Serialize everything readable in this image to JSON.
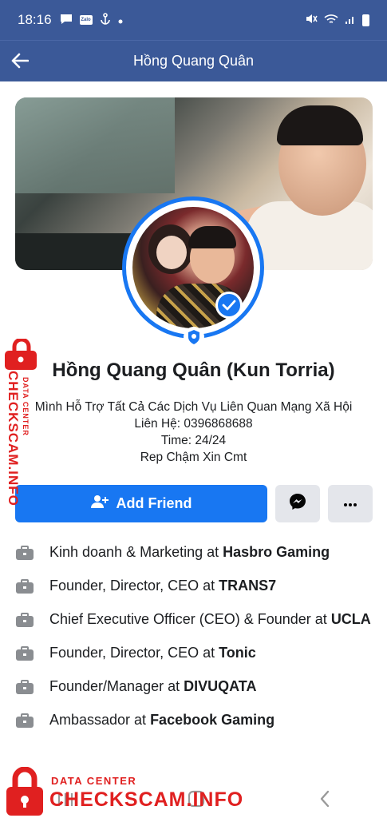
{
  "status_bar": {
    "time": "18:16",
    "left_icons": [
      "message-icon",
      "zalo-icon",
      "anchor-icon",
      "dot-icon"
    ],
    "zalo_label": "Zalo",
    "right_icons": [
      "mute-icon",
      "wifi-icon",
      "signal-icon",
      "battery-icon"
    ]
  },
  "header": {
    "title": "Hồng Quang Quân",
    "back_icon": "arrow-left-icon"
  },
  "profile": {
    "name": "Hồng Quang Quân (Kun Torria)",
    "bio": [
      "Mình Hỗ Trợ Tất Cả Các Dịch Vụ Liên Quan Mạng Xã Hội",
      "Liên Hệ: 0396868688",
      "Time: 24/24",
      "Rep Chậm Xin Cmt"
    ]
  },
  "actions": {
    "add_friend_label": "Add Friend",
    "messenger_icon": "messenger-icon",
    "more_icon": "more-icon"
  },
  "work": [
    {
      "role": "Kinh doanh & Marketing at ",
      "org": "Hasbro Gaming"
    },
    {
      "role": "Founder, Director, CEO at ",
      "org": "TRANS7"
    },
    {
      "role": "Chief Executive Officer (CEO) & Founder at ",
      "org": "UCLA"
    },
    {
      "role": "Founder, Director, CEO at ",
      "org": "Tonic"
    },
    {
      "role": "Founder/Manager at ",
      "org": "DIVUQATA"
    },
    {
      "role": "Ambassador at ",
      "org": "Facebook Gaming"
    }
  ],
  "watermark": {
    "line1": "DATA CENTER",
    "line2": "CHECKSCAM.INFO"
  },
  "colors": {
    "header_bg": "#3b5998",
    "accent": "#1877f2",
    "watermark": "#e02020"
  }
}
